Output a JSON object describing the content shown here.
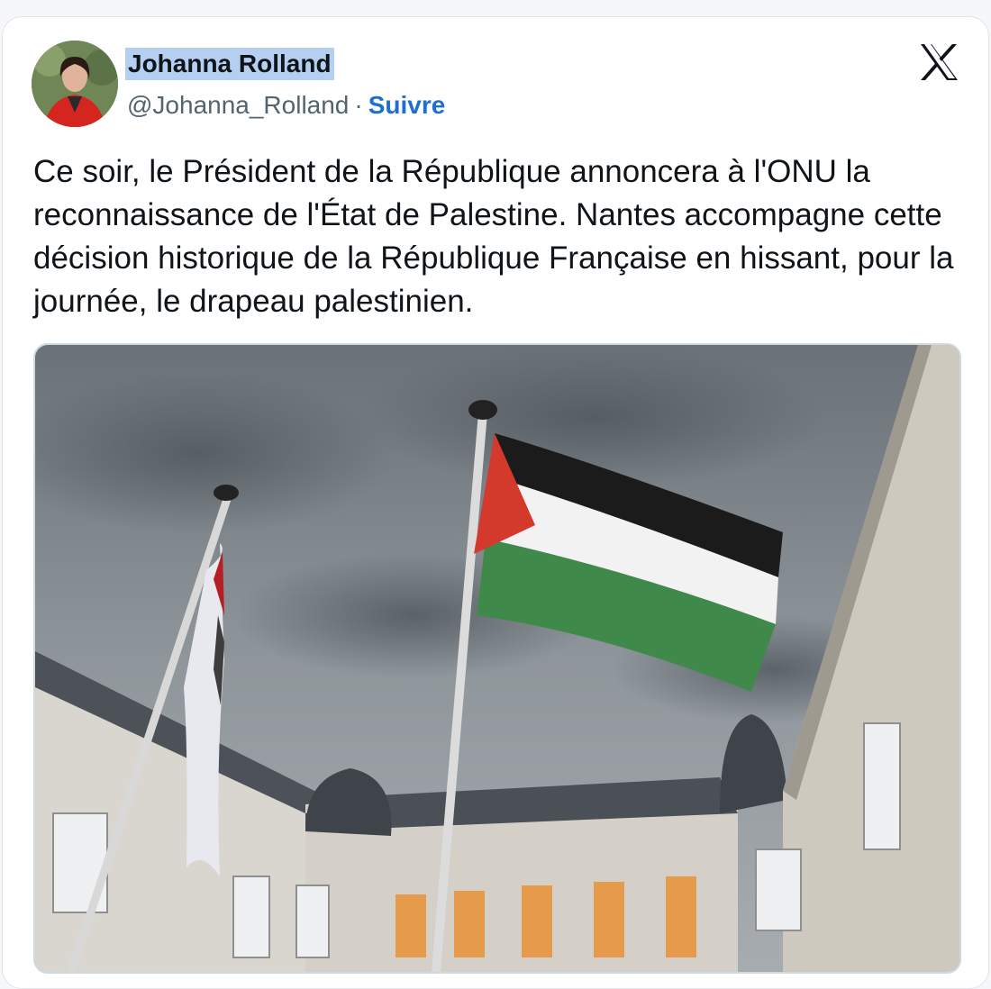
{
  "tweet": {
    "author_name": "Johanna Rolland",
    "author_handle": "@Johanna_Rolland",
    "separator": "·",
    "follow_label": "Suivre",
    "text": "Ce soir, le Président de la République annoncera à l'ONU la reconnaissance de l'État de Palestine. Nantes accompagne cette décision historique de la République Française en hissant, pour la journée, le drapeau palestinien.",
    "platform_logo": "x-logo-icon",
    "media_alt": "palestinian-flag-photo"
  },
  "colors": {
    "name_highlight": "#b4cff2",
    "follow_link": "#1d6fd1",
    "text_primary": "#0f1419",
    "text_secondary": "#536471",
    "flag_black": "#1b1b1b",
    "flag_white": "#f2f2f2",
    "flag_green": "#3f8a4a",
    "flag_red": "#d33a2c"
  }
}
